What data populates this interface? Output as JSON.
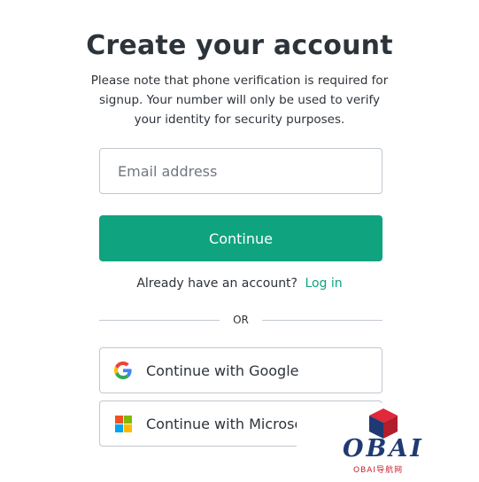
{
  "heading": {
    "title": "Create your account",
    "subtitle": "Please note that phone verification is required for signup. Your number will only be used to verify your identity for security purposes."
  },
  "form": {
    "email_placeholder": "Email address",
    "email_value": "",
    "continue_label": "Continue"
  },
  "login": {
    "prompt": "Already have an account?",
    "link_label": "Log in"
  },
  "divider": {
    "label": "OR"
  },
  "social": {
    "google": {
      "label": "Continue with Google",
      "icon": "google-icon"
    },
    "microsoft": {
      "label": "Continue with Microsof",
      "icon": "microsoft-icon"
    }
  },
  "watermark": {
    "brand": "OBAI",
    "tagline": "OBAI导航网"
  },
  "colors": {
    "accent": "#10a37f",
    "text": "#2d333a",
    "border": "#c2c8d0",
    "watermark_blue": "#1f3a73",
    "watermark_red": "#c8202f"
  }
}
